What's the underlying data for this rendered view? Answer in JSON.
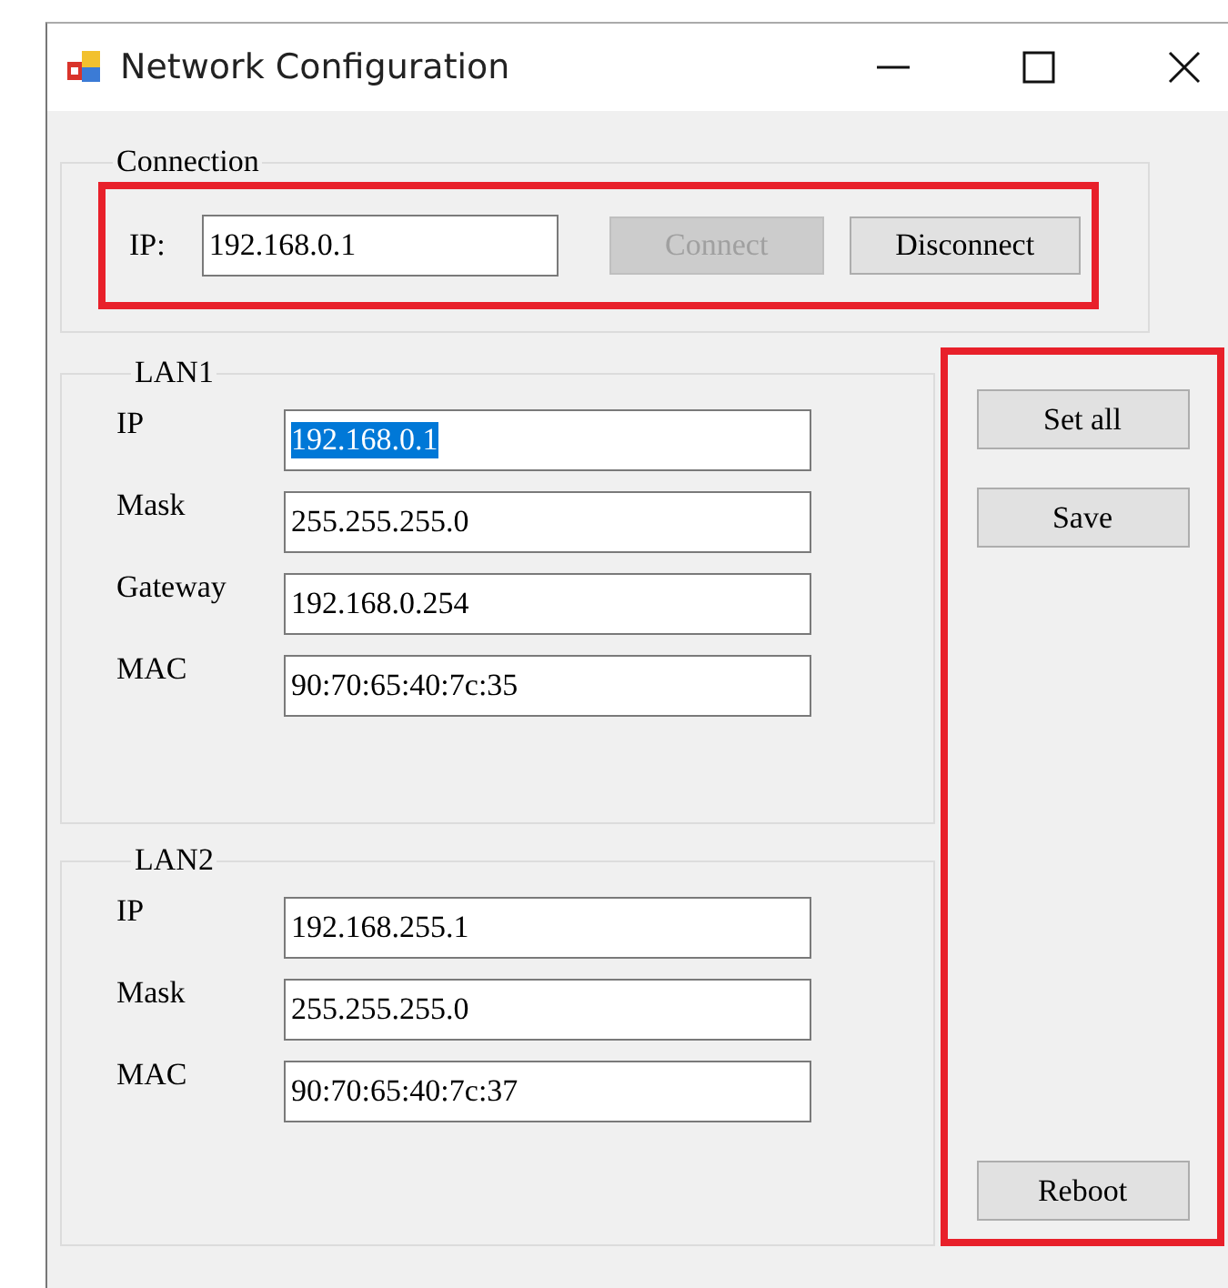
{
  "window": {
    "title": "Network Configuration"
  },
  "connection": {
    "title": "Connection",
    "ip_label": "IP:",
    "ip_value": "192.168.0.1",
    "buttons": [
      {
        "label": "Connect",
        "disabled": true
      },
      {
        "label": "Disconnect",
        "disabled": false
      }
    ]
  },
  "lans": [
    {
      "title": "LAN1",
      "fields": [
        {
          "label": "IP",
          "value": "192.168.0.1",
          "selected": true
        },
        {
          "label": "Mask",
          "value": "255.255.255.0",
          "selected": false
        },
        {
          "label": "Gateway",
          "value": "192.168.0.254",
          "selected": false
        },
        {
          "label": "MAC",
          "value": "90:70:65:40:7c:35",
          "selected": false
        }
      ]
    },
    {
      "title": "LAN2",
      "fields": [
        {
          "label": "IP",
          "value": "192.168.255.1",
          "selected": false
        },
        {
          "label": "Mask",
          "value": "255.255.255.0",
          "selected": false
        },
        {
          "label": "MAC",
          "value": "90:70:65:40:7c:37",
          "selected": false
        }
      ]
    }
  ],
  "actions": [
    {
      "label": "Set all"
    },
    {
      "label": "Save"
    }
  ],
  "footer_action": {
    "label": "Reboot"
  }
}
